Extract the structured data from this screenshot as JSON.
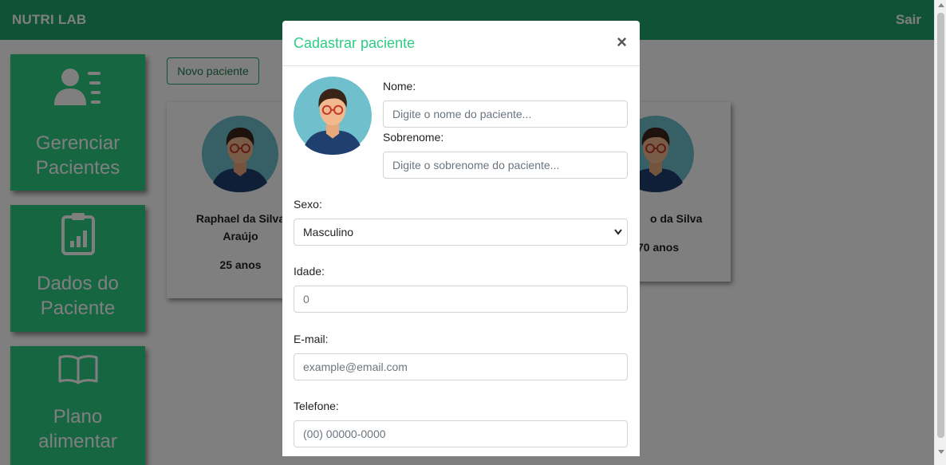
{
  "navbar": {
    "brand": "NUTRI LAB",
    "logout": "Sair",
    "color": "#1fa46a"
  },
  "sidebar": {
    "accent": "#2ecc84",
    "items": [
      {
        "label_line1": "Gerenciar",
        "label_line2": "Pacientes",
        "icon": "users-list-icon"
      },
      {
        "label_line1": "Dados do",
        "label_line2": "Paciente",
        "icon": "clipboard-chart-icon"
      },
      {
        "label_line1": "Plano",
        "label_line2": "alimentar",
        "icon": "open-book-icon"
      }
    ]
  },
  "main": {
    "new_patient_label": "Novo paciente",
    "patients": [
      {
        "name_line1": "Raphael da Silva",
        "name_line2": "Araújo",
        "age": "25 anos"
      },
      {
        "name_line1": "o da Silva",
        "age": "70 anos"
      }
    ]
  },
  "modal": {
    "title": "Cadastrar paciente",
    "close": "×",
    "fields": {
      "nome_label": "Nome:",
      "nome_placeholder": "Digite o nome do paciente...",
      "sobrenome_label": "Sobrenome:",
      "sobrenome_placeholder": "Digite o sobrenome do paciente...",
      "sexo_label": "Sexo:",
      "sexo_value": "Masculino",
      "idade_label": "Idade:",
      "idade_value": "0",
      "email_label": "E-mail:",
      "email_placeholder": "example@email.com",
      "telefone_label": "Telefone:",
      "telefone_placeholder": "(00) 00000-0000"
    }
  }
}
